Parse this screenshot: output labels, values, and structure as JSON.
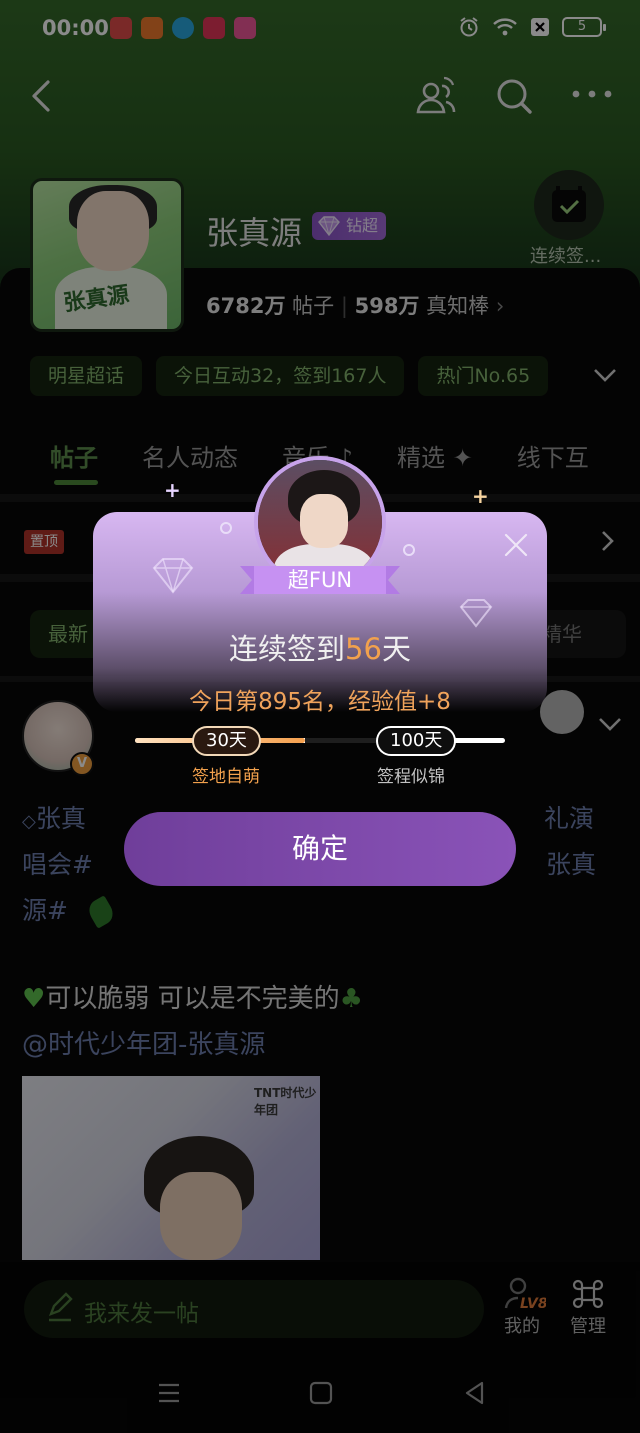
{
  "status_bar": {
    "time": "00:00",
    "battery": "5",
    "notification_colors": [
      "#e24c4b",
      "#f07a2d",
      "#2aa8e0",
      "#e5375a",
      "#f0579a"
    ]
  },
  "header": {
    "name": "张真源",
    "badge": "钻超",
    "checkin_label": "连续签...",
    "cover_text": "张真源",
    "posts_count": "6782万",
    "posts_label": "帖子",
    "fans_count": "598万",
    "fans_label": "真知棒"
  },
  "chips": [
    "明星超话",
    "今日互动32，签到167人",
    "热门No.65"
  ],
  "tabs": [
    "帖子",
    "名人动态",
    "音乐",
    "精选",
    "线下互"
  ],
  "pinned_label": "置顶",
  "sort": {
    "left": "最新",
    "right": "精华"
  },
  "post": {
    "verified": "V",
    "line1_left": "张真",
    "line1_right": "礼演",
    "line2_left": "唱会#",
    "line2_right": "张真",
    "line3": "源#",
    "body": "可以脆弱 可以是不完美的",
    "mention": "@时代少年团-张真源",
    "image_watermark": "TNT时代少年团"
  },
  "bottom": {
    "compose_placeholder": "我来发一帖",
    "mine_label": "我的",
    "mine_level": "LV8",
    "manage_label": "管理"
  },
  "modal": {
    "badge": "超FUN",
    "title_prefix": "连续签到",
    "days": "56",
    "title_suffix": "天",
    "rank_text": "今日第895名，经验值+8",
    "progress": 0.46,
    "milestone1": "30天",
    "milestone1_label": "签地自萌",
    "milestone2": "100天",
    "milestone2_label": "签程似锦",
    "confirm": "确定"
  },
  "colors": {
    "accent_green": "#5d8f4c",
    "modal_purple": "#8a53b8",
    "highlight_orange": "#f2a14d",
    "link_blue": "#6e7fae"
  }
}
